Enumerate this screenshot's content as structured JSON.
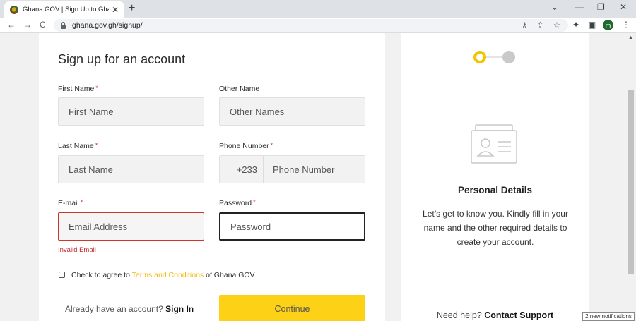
{
  "browser": {
    "tab_title": "Ghana.GOV | Sign Up to Ghana.G",
    "tab_close": "✕",
    "new_tab": "+",
    "url": "ghana.gov.gh/signup/",
    "profile_initial": "m",
    "nav_back": "←",
    "nav_forward": "→",
    "nav_reload": "C",
    "win_chevron": "⌄",
    "win_minimize": "—",
    "win_restore": "❐",
    "win_close": "✕",
    "icon_key": "⚷",
    "icon_share": "⇪",
    "icon_star": "☆",
    "icon_extensions": "✦",
    "icon_sidepanel": "▣",
    "icon_menu": "⋮"
  },
  "form": {
    "heading": "Sign up for an account",
    "required_mark": "*",
    "first_name": {
      "label": "First Name",
      "placeholder": "First Name"
    },
    "other_name": {
      "label": "Other Name",
      "placeholder": "Other Names"
    },
    "last_name": {
      "label": "Last Name",
      "placeholder": "Last Name"
    },
    "phone": {
      "label": "Phone Number",
      "code": "+233",
      "placeholder": "Phone Number"
    },
    "email": {
      "label": "E-mail",
      "placeholder": "Email Address",
      "error": "Invalid Email"
    },
    "password": {
      "label": "Password",
      "placeholder": "Password"
    },
    "terms": {
      "prefix": "Check to agree to",
      "link": "Terms and Conditions",
      "suffix": "of Ghana.GOV"
    },
    "signin_prompt": "Already have an account?",
    "signin_link": "Sign In",
    "continue_label": "Continue"
  },
  "side": {
    "title": "Personal Details",
    "description": "Let’s get to know you. Kindly fill in your name and the other required details to create your account.",
    "help_prefix": "Need help?",
    "help_link": "Contact Support",
    "steps_total": 2,
    "current_step": 1
  },
  "notification": "2 new notifications",
  "colors": {
    "accent": "#fcd116",
    "error": "#d0342c",
    "step_active": "#f5c400"
  },
  "icons": [
    "ghana-coat-of-arms-icon",
    "lock-icon",
    "key-icon",
    "share-icon",
    "star-icon",
    "extensions-icon",
    "id-card-icon"
  ]
}
